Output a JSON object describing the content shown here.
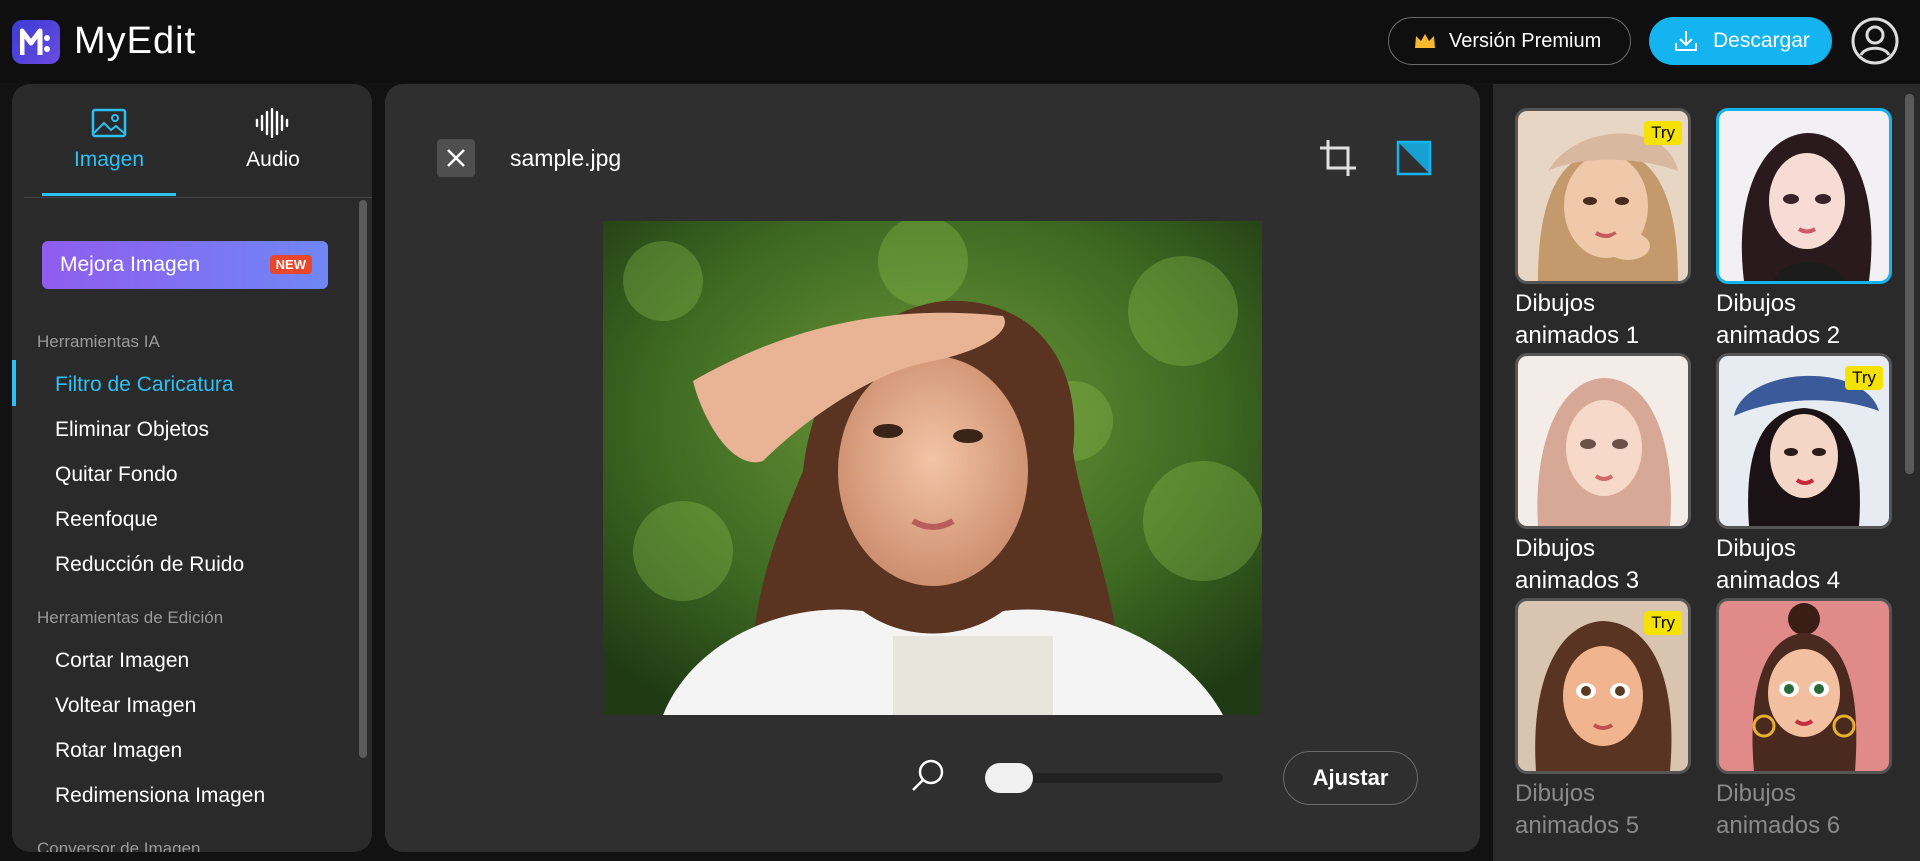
{
  "header": {
    "app_name": "MyEdit",
    "premium_label": "Versión Premium",
    "download_label": "Descargar"
  },
  "left": {
    "tabs": [
      {
        "label": "Imagen",
        "icon": "image-icon",
        "active": true
      },
      {
        "label": "Audio",
        "icon": "audio-wave-icon",
        "active": false
      }
    ],
    "mejora_label": "Mejora Imagen",
    "new_badge": "NEW",
    "sections": [
      {
        "title": "Herramientas IA",
        "items": [
          "Filtro de Caricatura",
          "Eliminar Objetos",
          "Quitar Fondo",
          "Reenfoque",
          "Reducción de Ruido"
        ]
      },
      {
        "title": "Herramientas de Edición",
        "items": [
          "Cortar Imagen",
          "Voltear Imagen",
          "Rotar Imagen",
          "Redimensiona Imagen"
        ]
      },
      {
        "title": "Conversor de Imagen",
        "items": []
      }
    ],
    "active_item": "Filtro de Caricatura"
  },
  "center": {
    "file_name": "sample.jpg",
    "zoom_level": 0.0,
    "ajustar_label": "Ajustar"
  },
  "right": {
    "styles": [
      {
        "label": "Dibujos animados 1",
        "try": "Try",
        "selected": false
      },
      {
        "label": "Dibujos animados 2",
        "try": "",
        "selected": true
      },
      {
        "label": "Dibujos animados 3",
        "try": "",
        "selected": false
      },
      {
        "label": "Dibujos animados 4",
        "try": "Try",
        "selected": false
      },
      {
        "label": "Dibujos animados 5",
        "try": "Try",
        "selected": false
      },
      {
        "label": "Dibujos animados 6",
        "try": "",
        "selected": false
      }
    ]
  },
  "colors": {
    "accent": "#14b4f0",
    "active_text": "#2cc0f5",
    "badge_new": "#e8472b",
    "badge_try": "#f5e200"
  }
}
